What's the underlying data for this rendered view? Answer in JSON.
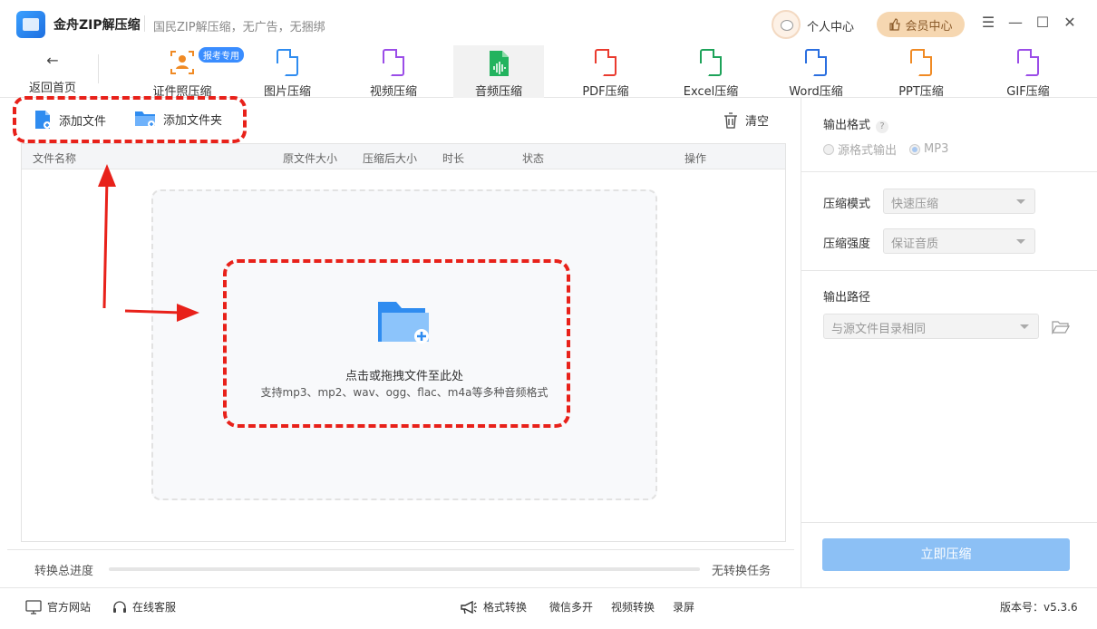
{
  "app": {
    "title": "金舟ZIP解压缩",
    "slogan": "国民ZIP解压缩，无广告，无捆绑"
  },
  "header": {
    "user_center": "个人中心",
    "vip_center": "会员中心"
  },
  "toolbar": {
    "back_label": "返回首页",
    "badge": "报考专用",
    "tools": [
      {
        "label": "证件照压缩",
        "color": "#f08a24"
      },
      {
        "label": "图片压缩",
        "color": "#2f8cf0"
      },
      {
        "label": "视频压缩",
        "color": "#9b4de8"
      },
      {
        "label": "音频压缩",
        "color": "#22b35e"
      },
      {
        "label": "PDF压缩",
        "color": "#ea3b2f"
      },
      {
        "label": "Excel压缩",
        "color": "#1ea35a"
      },
      {
        "label": "Word压缩",
        "color": "#2b6fe0"
      },
      {
        "label": "PPT压缩",
        "color": "#f08a24"
      },
      {
        "label": "GIF压缩",
        "color": "#9b4de8"
      }
    ],
    "active_index": 3
  },
  "actions": {
    "add_file": "添加文件",
    "add_folder": "添加文件夹",
    "clear": "清空"
  },
  "table": {
    "columns": [
      "文件名称",
      "原文件大小",
      "压缩后大小",
      "时长",
      "状态",
      "操作"
    ]
  },
  "dropzone": {
    "main": "点击或拖拽文件至此处",
    "sub": "支持mp3、mp2、wav、ogg、flac、m4a等多种音频格式"
  },
  "progress": {
    "label": "转换总进度",
    "value": 0,
    "status": "无转换任务"
  },
  "settings": {
    "output_format_label": "输出格式",
    "help": "?",
    "format_options": [
      "源格式输出",
      "MP3"
    ],
    "format_selected": "MP3",
    "compress_mode_label": "压缩模式",
    "compress_mode_value": "快速压缩",
    "compress_strength_label": "压缩强度",
    "compress_strength_value": "保证音质",
    "output_path_label": "输出路径",
    "output_path_value": "与源文件目录相同",
    "compress_button": "立即压缩"
  },
  "footer": {
    "official_site": "官方网站",
    "online_service": "在线客服",
    "format_convert": "格式转换",
    "wechat_multi": "微信多开",
    "video_convert": "视频转换",
    "screen_record": "录屏",
    "version": "版本号：v5.3.6"
  },
  "colors": {
    "accent": "#3a8dff",
    "annotation": "#e8211a",
    "vip_bg": "#f6d7b1",
    "compress_button": "#8cc0f5"
  }
}
